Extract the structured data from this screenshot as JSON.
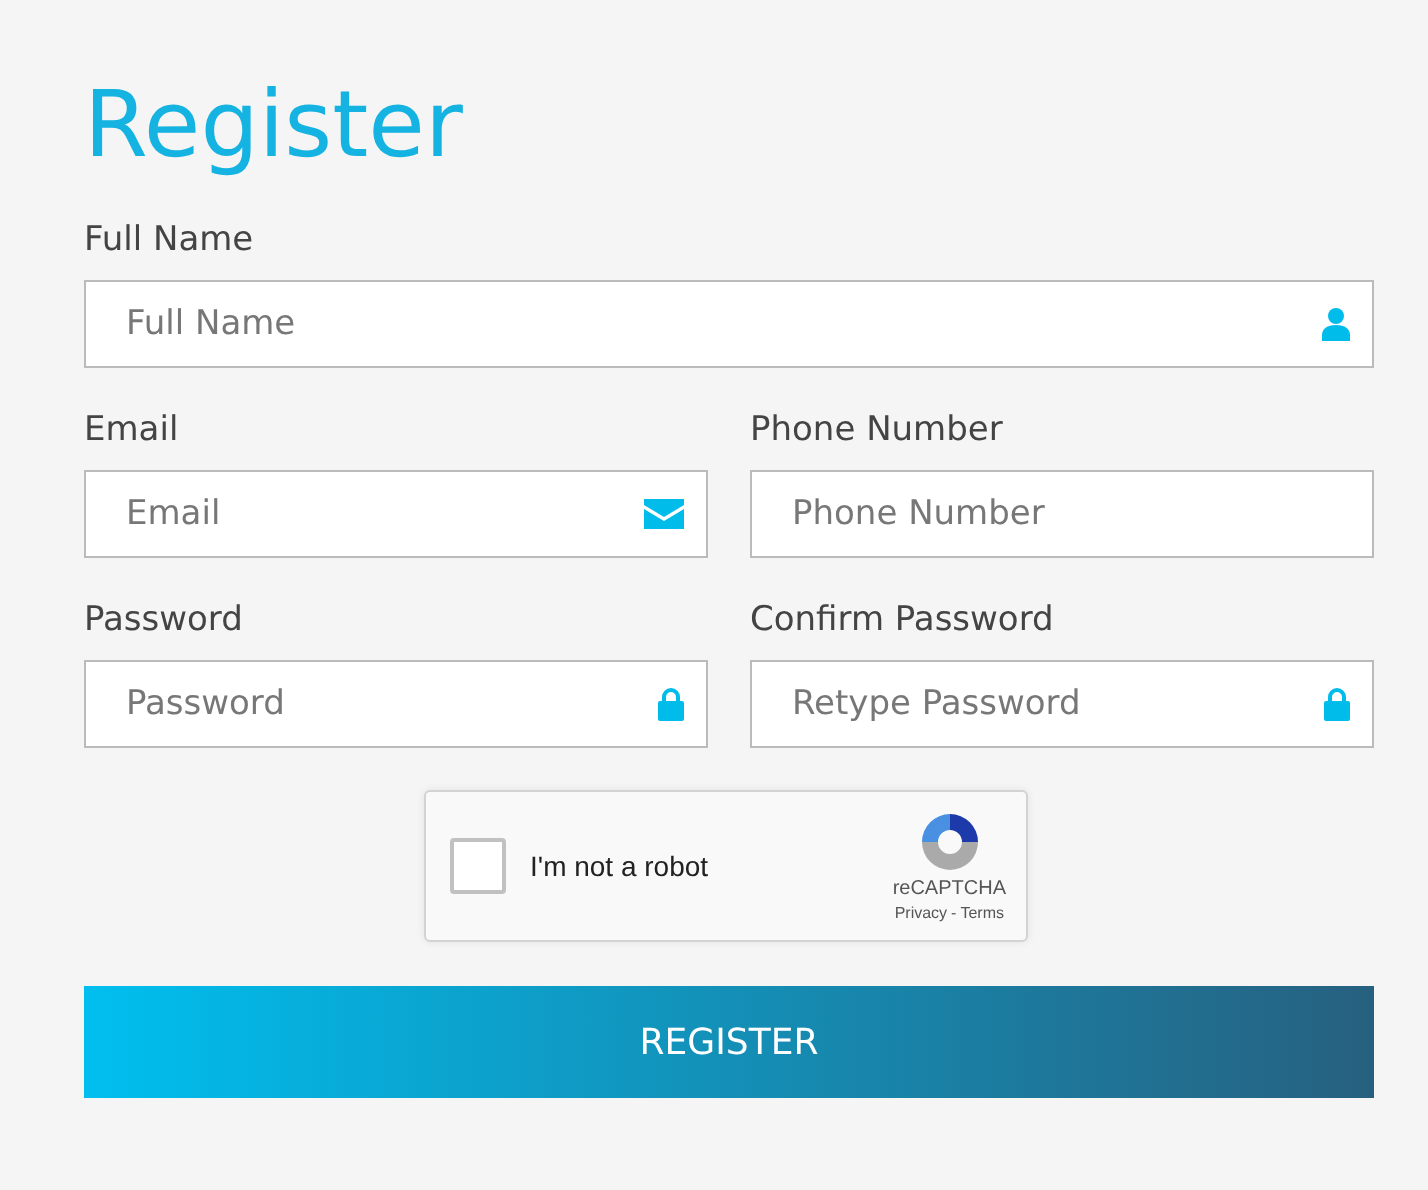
{
  "title": "Register",
  "rows": [
    [
      {
        "label": "Full Name",
        "placeholder": "Full Name",
        "kind": "name"
      }
    ],
    [
      {
        "label": "Email",
        "placeholder": "Email",
        "kind": "email"
      },
      {
        "label": "Phone Number",
        "placeholder": "Phone Number",
        "kind": "phone"
      }
    ],
    [
      {
        "label": "Password",
        "placeholder": "Password",
        "kind": "password"
      },
      {
        "label": "Confirm Password",
        "placeholder": "Retype Password",
        "kind": "password"
      }
    ]
  ],
  "captcha": {
    "label": "I'm not a robot",
    "checked": false,
    "brand": "reCAPTCHA",
    "privacy": "Privacy",
    "separator": "-",
    "terms": "Terms"
  },
  "submit": "REGISTER"
}
